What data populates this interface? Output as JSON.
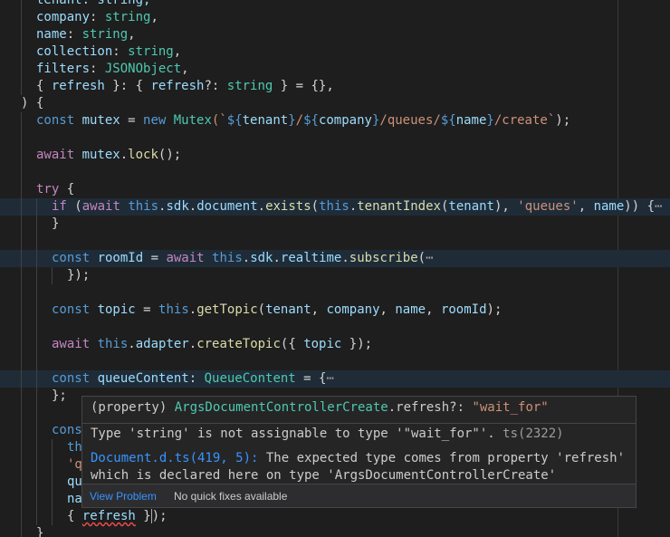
{
  "editor": {
    "lines": [
      {
        "hl": false,
        "indent": 40,
        "tokens": [
          [
            "tenant: string,",
            "var"
          ]
        ]
      },
      {
        "hl": false,
        "indent": 40,
        "tokens": [
          [
            "company",
            "var"
          ],
          [
            ": ",
            "punc"
          ],
          [
            "string",
            "type"
          ],
          [
            ",",
            "punc"
          ]
        ]
      },
      {
        "hl": false,
        "indent": 40,
        "tokens": [
          [
            "name",
            "var"
          ],
          [
            ": ",
            "punc"
          ],
          [
            "string",
            "type"
          ],
          [
            ",",
            "punc"
          ]
        ]
      },
      {
        "hl": false,
        "indent": 40,
        "tokens": [
          [
            "collection",
            "var"
          ],
          [
            ": ",
            "punc"
          ],
          [
            "string",
            "type"
          ],
          [
            ",",
            "punc"
          ]
        ]
      },
      {
        "hl": false,
        "indent": 40,
        "tokens": [
          [
            "filters",
            "var"
          ],
          [
            ": ",
            "punc"
          ],
          [
            "JSONObject",
            "type"
          ],
          [
            ",",
            "punc"
          ]
        ]
      },
      {
        "hl": false,
        "indent": 40,
        "tokens": [
          [
            "{ ",
            "punc"
          ],
          [
            "refresh",
            "var"
          ],
          [
            " }: { ",
            "punc"
          ],
          [
            "refresh",
            "var"
          ],
          [
            "?: ",
            "punc"
          ],
          [
            "string",
            "type"
          ],
          [
            " } = {},",
            "punc"
          ]
        ]
      },
      {
        "hl": false,
        "indent": 23,
        "tokens": [
          [
            ") {",
            "punc"
          ]
        ]
      },
      {
        "hl": false,
        "indent": 40,
        "tokens": [
          [
            "const ",
            "kw"
          ],
          [
            "mutex",
            "var"
          ],
          [
            " = ",
            "punc"
          ],
          [
            "new ",
            "kw"
          ],
          [
            "Mutex",
            "type"
          ],
          [
            "(`",
            "str"
          ],
          [
            "${",
            "kw"
          ],
          [
            "tenant",
            "var"
          ],
          [
            "}",
            "kw"
          ],
          [
            "/",
            "str"
          ],
          [
            "${",
            "kw"
          ],
          [
            "company",
            "var"
          ],
          [
            "}",
            "kw"
          ],
          [
            "/queues/",
            "str"
          ],
          [
            "${",
            "kw"
          ],
          [
            "name",
            "var"
          ],
          [
            "}",
            "kw"
          ],
          [
            "/create`",
            "str"
          ],
          [
            ");",
            "punc"
          ]
        ]
      },
      {
        "hl": false,
        "indent": 40,
        "tokens": []
      },
      {
        "hl": false,
        "indent": 40,
        "tokens": [
          [
            "await ",
            "ctrl"
          ],
          [
            "mutex",
            "var"
          ],
          [
            ".",
            "punc"
          ],
          [
            "lock",
            "fn"
          ],
          [
            "();",
            "punc"
          ]
        ]
      },
      {
        "hl": false,
        "indent": 40,
        "tokens": []
      },
      {
        "hl": false,
        "indent": 40,
        "tokens": [
          [
            "try ",
            "ctrl"
          ],
          [
            "{",
            "punc"
          ]
        ]
      },
      {
        "hl": true,
        "indent": 57,
        "tokens": [
          [
            "if ",
            "ctrl"
          ],
          [
            "(",
            "punc"
          ],
          [
            "await ",
            "ctrl"
          ],
          [
            "this",
            "kw"
          ],
          [
            ".",
            "punc"
          ],
          [
            "sdk",
            "var"
          ],
          [
            ".",
            "punc"
          ],
          [
            "document",
            "var"
          ],
          [
            ".",
            "punc"
          ],
          [
            "exists",
            "fn"
          ],
          [
            "(",
            "punc"
          ],
          [
            "this",
            "kw"
          ],
          [
            ".",
            "punc"
          ],
          [
            "tenantIndex",
            "fn"
          ],
          [
            "(",
            "punc"
          ],
          [
            "tenant",
            "var"
          ],
          [
            "), ",
            "punc"
          ],
          [
            "'queues'",
            "str"
          ],
          [
            ", ",
            "punc"
          ],
          [
            "name",
            "var"
          ],
          [
            ")) {",
            "punc"
          ],
          [
            "⋯",
            "fold"
          ]
        ]
      },
      {
        "hl": false,
        "indent": 57,
        "tokens": [
          [
            "}",
            "punc"
          ]
        ]
      },
      {
        "hl": false,
        "indent": 57,
        "tokens": []
      },
      {
        "hl": true,
        "indent": 57,
        "tokens": [
          [
            "const ",
            "kw"
          ],
          [
            "roomId",
            "var"
          ],
          [
            " = ",
            "punc"
          ],
          [
            "await ",
            "ctrl"
          ],
          [
            "this",
            "kw"
          ],
          [
            ".",
            "punc"
          ],
          [
            "sdk",
            "var"
          ],
          [
            ".",
            "punc"
          ],
          [
            "realtime",
            "var"
          ],
          [
            ".",
            "punc"
          ],
          [
            "subscribe",
            "fn"
          ],
          [
            "(",
            "punc"
          ],
          [
            "⋯",
            "fold"
          ]
        ]
      },
      {
        "hl": false,
        "indent": 74,
        "tokens": [
          [
            "});",
            "punc"
          ]
        ]
      },
      {
        "hl": false,
        "indent": 57,
        "tokens": []
      },
      {
        "hl": false,
        "indent": 57,
        "tokens": [
          [
            "const ",
            "kw"
          ],
          [
            "topic",
            "var"
          ],
          [
            " = ",
            "punc"
          ],
          [
            "this",
            "kw"
          ],
          [
            ".",
            "punc"
          ],
          [
            "getTopic",
            "fn"
          ],
          [
            "(",
            "punc"
          ],
          [
            "tenant",
            "var"
          ],
          [
            ", ",
            "punc"
          ],
          [
            "company",
            "var"
          ],
          [
            ", ",
            "punc"
          ],
          [
            "name",
            "var"
          ],
          [
            ", ",
            "punc"
          ],
          [
            "roomId",
            "var"
          ],
          [
            ");",
            "punc"
          ]
        ]
      },
      {
        "hl": false,
        "indent": 57,
        "tokens": []
      },
      {
        "hl": false,
        "indent": 57,
        "tokens": [
          [
            "await ",
            "ctrl"
          ],
          [
            "this",
            "kw"
          ],
          [
            ".",
            "punc"
          ],
          [
            "adapter",
            "var"
          ],
          [
            ".",
            "punc"
          ],
          [
            "createTopic",
            "fn"
          ],
          [
            "({ ",
            "punc"
          ],
          [
            "topic",
            "var"
          ],
          [
            " });",
            "punc"
          ]
        ]
      },
      {
        "hl": false,
        "indent": 57,
        "tokens": []
      },
      {
        "hl": true,
        "indent": 57,
        "tokens": [
          [
            "const ",
            "kw"
          ],
          [
            "queueContent",
            "var"
          ],
          [
            ": ",
            "punc"
          ],
          [
            "QueueContent",
            "type"
          ],
          [
            " = {",
            "punc"
          ],
          [
            "⋯",
            "fold"
          ]
        ]
      },
      {
        "hl": false,
        "indent": 57,
        "tokens": [
          [
            "};",
            "punc"
          ]
        ]
      },
      {
        "hl": false,
        "indent": 57,
        "tokens": []
      },
      {
        "hl": false,
        "indent": 57,
        "tokens": [
          [
            "cons",
            "kw"
          ]
        ]
      },
      {
        "hl": false,
        "indent": 74,
        "tokens": [
          [
            "th",
            "kw"
          ]
        ]
      },
      {
        "hl": false,
        "indent": 74,
        "tokens": [
          [
            "'q",
            "str"
          ]
        ]
      },
      {
        "hl": false,
        "indent": 74,
        "tokens": [
          [
            "qu",
            "var"
          ]
        ]
      },
      {
        "hl": false,
        "indent": 74,
        "tokens": [
          [
            "na",
            "var"
          ]
        ]
      },
      {
        "hl": false,
        "indent": 74,
        "tokens": [
          [
            "{ ",
            "punc"
          ],
          [
            "refresh",
            "var",
            "squiggle"
          ],
          [
            " }",
            "punc"
          ],
          [
            "|",
            "cursor"
          ],
          [
            ");",
            "punc"
          ]
        ]
      },
      {
        "hl": false,
        "indent": 40,
        "tokens": [
          [
            "}",
            "punc"
          ]
        ]
      }
    ]
  },
  "hover": {
    "signature_prefix": "(property) ",
    "signature_type": "ArgsDocumentControllerCreate",
    "signature_member": ".refresh?: ",
    "signature_value": "\"wait_for\"",
    "error_text": "Type 'string' is not assignable to type '\"wait_for\"'. ",
    "error_code": "ts(2322)",
    "related_link": "Document.d.ts(419, 5):",
    "related_text": " The expected type comes from property 'refresh'",
    "related_text_2": "which is declared here on type 'ArgsDocumentControllerCreate'",
    "view_problem": "View Problem",
    "no_quick_fixes": "No quick fixes available"
  },
  "colors": {
    "background": "#1e1e1e",
    "keyword": "#569cd6",
    "control": "#c586c0",
    "variable": "#9cdcfe",
    "type": "#4ec9b0",
    "function": "#dcdcaa",
    "string": "#ce9178",
    "link": "#3794ff",
    "error": "#f14c4c"
  }
}
